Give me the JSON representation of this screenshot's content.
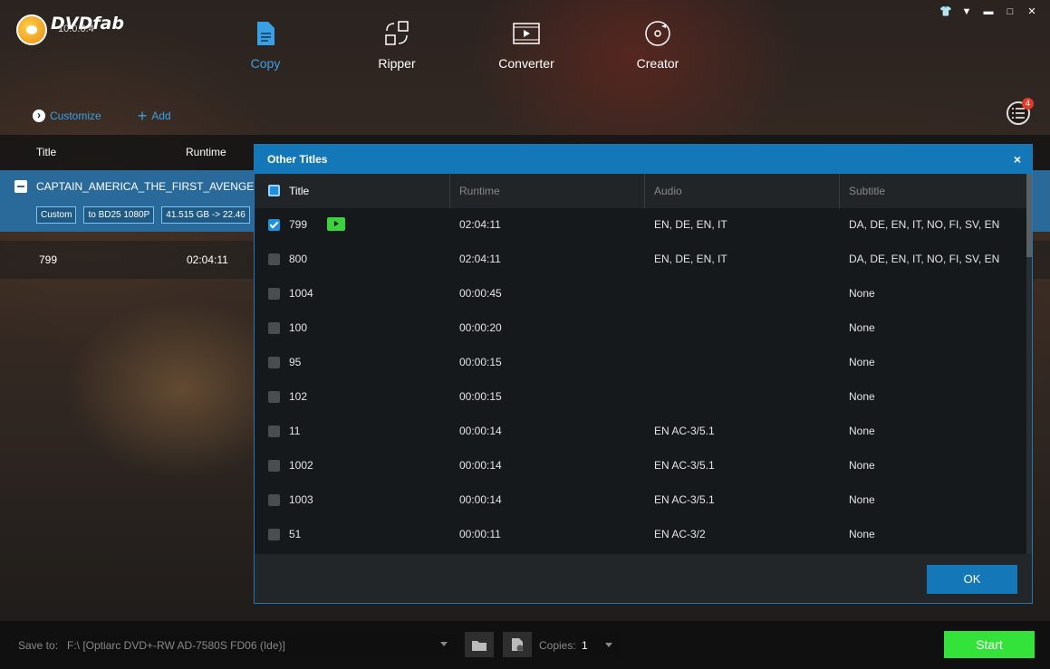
{
  "app": {
    "logo_text": "DVDfab",
    "version": "10.0.0.4"
  },
  "nav": [
    {
      "label": "Copy",
      "active": true
    },
    {
      "label": "Ripper",
      "active": false
    },
    {
      "label": "Converter",
      "active": false
    },
    {
      "label": "Creator",
      "active": false
    }
  ],
  "toolbar": {
    "customize_label": "Customize",
    "add_label": "Add",
    "queue_count": "4"
  },
  "list": {
    "headers": {
      "title": "Title",
      "runtime": "Runtime"
    },
    "movie": {
      "title": "CAPTAIN_AMERICA_THE_FIRST_AVENGER",
      "tags": [
        "Custom",
        "to BD25 1080P",
        "41.515 GB -> 22.46"
      ]
    },
    "sub_row": {
      "title": "799",
      "runtime": "02:04:11"
    }
  },
  "dialog": {
    "title": "Other Titles",
    "close_label": "×",
    "columns": {
      "title": "Title",
      "runtime": "Runtime",
      "audio": "Audio",
      "subtitle": "Subtitle"
    },
    "rows": [
      {
        "title": "799",
        "runtime": "02:04:11",
        "audio": "EN, DE, EN, IT",
        "subtitle": "DA, DE, EN, IT, NO, FI, SV, EN",
        "checked": true
      },
      {
        "title": "800",
        "runtime": "02:04:11",
        "audio": "EN, DE, EN, IT",
        "subtitle": "DA, DE, EN, IT, NO, FI, SV, EN",
        "checked": false
      },
      {
        "title": "1004",
        "runtime": "00:00:45",
        "audio": "",
        "subtitle": "None",
        "checked": false
      },
      {
        "title": "100",
        "runtime": "00:00:20",
        "audio": "",
        "subtitle": "None",
        "checked": false
      },
      {
        "title": "95",
        "runtime": "00:00:15",
        "audio": "",
        "subtitle": "None",
        "checked": false
      },
      {
        "title": "102",
        "runtime": "00:00:15",
        "audio": "",
        "subtitle": "None",
        "checked": false
      },
      {
        "title": "11",
        "runtime": "00:00:14",
        "audio": "EN  AC-3/5.1",
        "subtitle": "None",
        "checked": false
      },
      {
        "title": "1002",
        "runtime": "00:00:14",
        "audio": "EN  AC-3/5.1",
        "subtitle": "None",
        "checked": false
      },
      {
        "title": "1003",
        "runtime": "00:00:14",
        "audio": "EN  AC-3/5.1",
        "subtitle": "None",
        "checked": false
      },
      {
        "title": "51",
        "runtime": "00:00:11",
        "audio": "EN  AC-3/2",
        "subtitle": "None",
        "checked": false
      }
    ],
    "ok_label": "OK"
  },
  "bottom": {
    "save_label": "Save to:",
    "save_path": "F:\\ [Optiarc DVD+-RW AD-7580S FD06 (Ide)]",
    "copies_label": "Copies:",
    "copies_value": "1",
    "start_label": "Start"
  },
  "colors": {
    "accent": "#1478b8",
    "start": "#34e33a",
    "active_nav": "#3aa0e6"
  }
}
